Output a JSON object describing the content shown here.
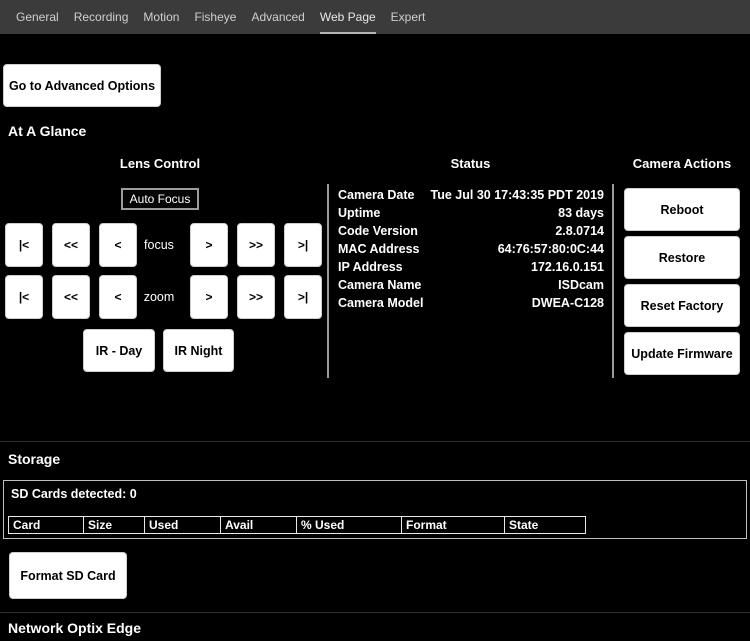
{
  "nav": {
    "tabs": [
      {
        "label": "General"
      },
      {
        "label": "Recording"
      },
      {
        "label": "Motion"
      },
      {
        "label": "Fisheye"
      },
      {
        "label": "Advanced"
      },
      {
        "label": "Web Page"
      },
      {
        "label": "Expert"
      }
    ],
    "active_tab": "Web Page"
  },
  "buttons": {
    "goto_advanced": "Go to Advanced Options"
  },
  "glance": {
    "title": "At A Glance",
    "lens": {
      "title": "Lens Control",
      "auto_focus": "Auto Focus",
      "focus_label": "focus",
      "zoom_label": "zoom",
      "step_left": [
        "|<",
        "<<",
        "<"
      ],
      "step_right": [
        ">",
        ">>",
        ">|"
      ],
      "ir_day": "IR - Day",
      "ir_night": "IR Night"
    },
    "status": {
      "title": "Status",
      "rows": [
        {
          "label": "Camera Date",
          "value": "Tue Jul 30 17:43:35 PDT 2019"
        },
        {
          "label": "Uptime",
          "value": "83 days"
        },
        {
          "label": "Code Version",
          "value": "2.8.0714"
        },
        {
          "label": "MAC Address",
          "value": "64:76:57:80:0C:44"
        },
        {
          "label": "IP Address",
          "value": "172.16.0.151"
        },
        {
          "label": "Camera Name",
          "value": "ISDcam"
        },
        {
          "label": "Camera Model",
          "value": "DWEA-C128"
        }
      ]
    },
    "actions": {
      "title": "Camera Actions",
      "buttons": [
        "Reboot",
        "Restore",
        "Reset Factory",
        "Update Firmware"
      ]
    }
  },
  "storage": {
    "title": "Storage",
    "detected": "SD Cards detected: 0",
    "headers": [
      "Card",
      "Size",
      "Used",
      "Avail",
      "% Used",
      "Format",
      "State"
    ],
    "format_button": "Format SD Card"
  },
  "footer": {
    "title": "Network Optix Edge"
  },
  "colors": {
    "nav_bg": "#3b3b3b",
    "page_bg": "#000000",
    "button_bg": "#ffffff",
    "nav_text": "#cfcfcf"
  }
}
